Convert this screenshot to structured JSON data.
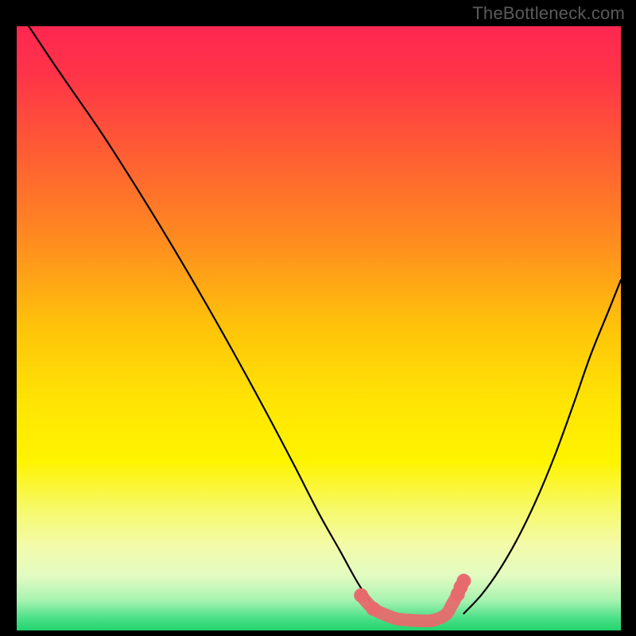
{
  "watermark": "TheBottleneck.com",
  "chart_data": {
    "type": "line",
    "title": "",
    "xlabel": "",
    "ylabel": "",
    "xlim": [
      0,
      100
    ],
    "ylim": [
      0,
      100
    ],
    "gradient_stops": [
      {
        "offset": 0.0,
        "color": "#ff2751"
      },
      {
        "offset": 0.08,
        "color": "#ff3448"
      },
      {
        "offset": 0.2,
        "color": "#ff5a35"
      },
      {
        "offset": 0.35,
        "color": "#ff8a20"
      },
      {
        "offset": 0.5,
        "color": "#ffc40a"
      },
      {
        "offset": 0.62,
        "color": "#ffe404"
      },
      {
        "offset": 0.72,
        "color": "#fff400"
      },
      {
        "offset": 0.8,
        "color": "#f6f96a"
      },
      {
        "offset": 0.86,
        "color": "#f3fbaa"
      },
      {
        "offset": 0.91,
        "color": "#e3fbc2"
      },
      {
        "offset": 0.95,
        "color": "#a7f3b0"
      },
      {
        "offset": 0.98,
        "color": "#4be087"
      },
      {
        "offset": 1.0,
        "color": "#22d36e"
      }
    ],
    "series": [
      {
        "name": "left-curve",
        "x": [
          2,
          6,
          10,
          14,
          18,
          22,
          26,
          30,
          34,
          38,
          42,
          46,
          50,
          53.5,
          56.5,
          59.5
        ],
        "y": [
          100,
          94,
          88.2,
          82.4,
          76.2,
          69.8,
          63.2,
          56.4,
          49.4,
          42.2,
          34.8,
          27.2,
          19.4,
          13.2,
          7.8,
          3.2
        ]
      },
      {
        "name": "right-curve",
        "x": [
          74,
          77,
          80,
          83,
          86,
          89,
          92,
          95,
          98,
          100
        ],
        "y": [
          2.8,
          6.0,
          10.2,
          15.4,
          21.6,
          28.8,
          37.0,
          45.6,
          53.0,
          58.0
        ]
      }
    ],
    "accent_zone": {
      "name": "accent-dots",
      "color": "#e76a6d",
      "x": [
        57,
        59,
        61.5,
        63,
        65,
        67,
        69,
        71,
        72,
        73,
        73.5,
        74
      ],
      "y": [
        5.8,
        3.6,
        2.4,
        1.9,
        1.7,
        1.6,
        1.7,
        2.6,
        4.2,
        6.0,
        7.2,
        8.2
      ]
    }
  }
}
